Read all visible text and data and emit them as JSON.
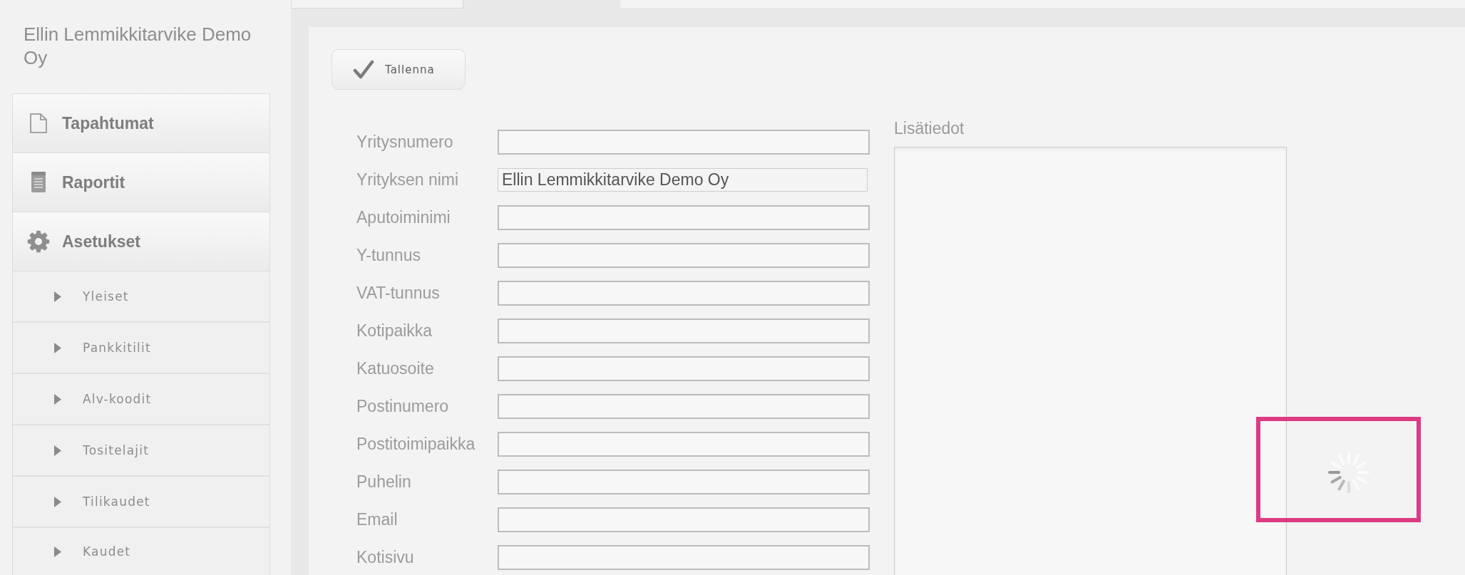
{
  "sidebar": {
    "company_name": "Ellin Lemmikkitarvike Demo Oy",
    "items": [
      {
        "label": "Tapahtumat"
      },
      {
        "label": "Raportit"
      },
      {
        "label": "Asetukset",
        "children": [
          {
            "label": "Yleiset",
            "expanded": false
          },
          {
            "label": "Pankkitilit",
            "expanded": false
          },
          {
            "label": "Alv-koodit",
            "expanded": false
          },
          {
            "label": "Tositelajit",
            "expanded": false
          },
          {
            "label": "Tilikaudet",
            "expanded": false
          },
          {
            "label": "Kaudet",
            "expanded": false
          }
        ]
      }
    ]
  },
  "toolbar": {
    "save_button": "Tallenna"
  },
  "form": {
    "fields": [
      {
        "label": "Yritysnumero",
        "readonly": false
      },
      {
        "label": "Yrityksen nimi",
        "value": "Ellin Lemmikkitarvike Demo Oy",
        "readonly": true
      },
      {
        "label": "Aputoiminimi",
        "readonly": false
      },
      {
        "label": "Y-tunnus",
        "readonly": false
      },
      {
        "label": "VAT-tunnus",
        "readonly": false
      },
      {
        "label": "Kotipaikka",
        "readonly": false
      },
      {
        "label": "Katuosoite",
        "readonly": false
      },
      {
        "label": "Postinumero",
        "readonly": false
      },
      {
        "label": "Postitoimipaikka",
        "readonly": false
      },
      {
        "label": "Puhelin",
        "readonly": false
      },
      {
        "label": "Email",
        "readonly": false
      },
      {
        "label": "Kotisivu",
        "readonly": false
      }
    ]
  },
  "notes": {
    "label": "Lisätiedot"
  },
  "spinner": {
    "highlighted": true
  }
}
